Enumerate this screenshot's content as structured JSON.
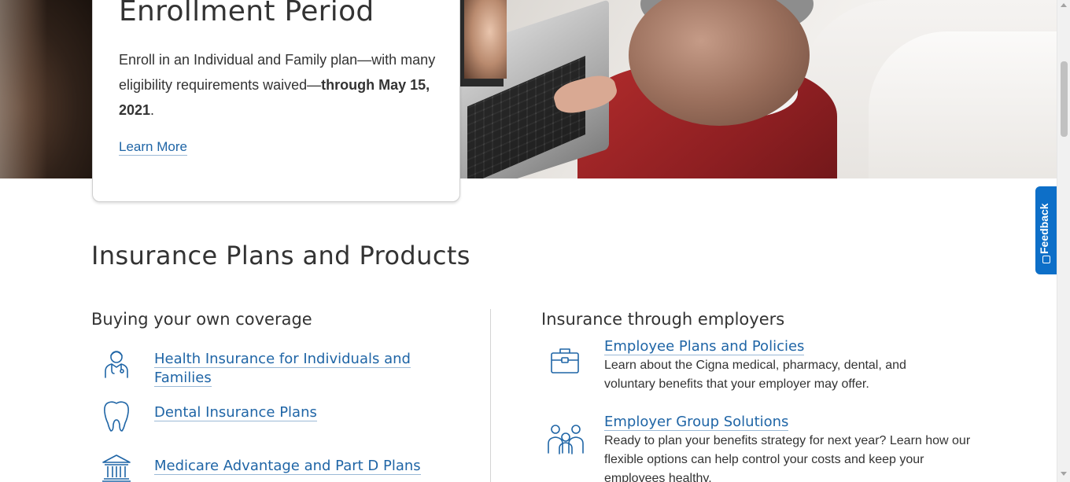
{
  "hero": {
    "title": "Enrollment Period",
    "body_prefix": "Enroll in an Individual and Family plan—with many eligibility requirements waived—",
    "body_bold": "through May 15, 2021",
    "body_suffix": ".",
    "cta_label": "Learn More"
  },
  "section": {
    "title": "Insurance Plans and Products"
  },
  "own_coverage": {
    "heading": "Buying your own coverage",
    "items": [
      {
        "label": "Health Insurance for Individuals and Families",
        "icon": "doctor-icon"
      },
      {
        "label": "Dental Insurance Plans",
        "icon": "tooth-icon"
      },
      {
        "label": "Medicare Advantage and Part D Plans",
        "icon": "building-columns-icon"
      }
    ]
  },
  "employers": {
    "heading": "Insurance through employers",
    "items": [
      {
        "label": "Employee Plans and Policies",
        "description": "Learn about the Cigna medical, pharmacy, dental, and voluntary benefits that your employer may offer.",
        "icon": "briefcase-icon"
      },
      {
        "label": "Employer Group Solutions",
        "description": "Ready to plan your benefits strategy for next year? Learn how our flexible options can help control your costs and keep your employees healthy.",
        "icon": "group-people-icon"
      }
    ]
  },
  "feedback": {
    "label": "Feedback"
  },
  "colors": {
    "link": "#1f65a6",
    "icon": "#1f65a6",
    "feedback_bg": "#0d6fc8",
    "text": "#333333"
  }
}
